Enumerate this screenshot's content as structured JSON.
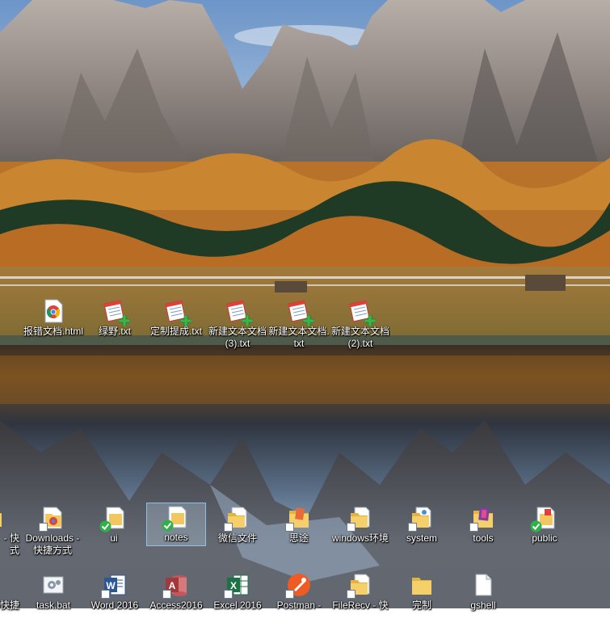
{
  "desktop": {
    "row1": [
      {
        "label": "报错文档.html",
        "icon": "chrome-html-file-icon"
      },
      {
        "label": "绿野.txt",
        "icon": "notepad-text-file-icon"
      },
      {
        "label": "定制提成.txt",
        "icon": "notepad-text-file-icon"
      },
      {
        "label": "新建文本文档 (3).txt",
        "icon": "notepad-text-file-icon"
      },
      {
        "label": "新建文本文档.txt",
        "icon": "notepad-text-file-icon"
      },
      {
        "label": "新建文本文档 (2).txt",
        "icon": "notepad-text-file-icon"
      }
    ],
    "row2": [
      {
        "label": "- 快\n式",
        "icon": "folder-shortcut-icon"
      },
      {
        "label": "Downloads - 快捷方式",
        "icon": "folder-shortcut-icon"
      },
      {
        "label": "ui",
        "icon": "synced-folder-icon"
      },
      {
        "label": "notes",
        "icon": "synced-folder-icon"
      },
      {
        "label": "微信文件",
        "icon": "folder-shortcut-icon"
      },
      {
        "label": "思途",
        "icon": "folder-shortcut-icon"
      },
      {
        "label": "windows环境",
        "icon": "folder-shortcut-icon"
      },
      {
        "label": "system",
        "icon": "folder-shortcut-icon"
      },
      {
        "label": "tools",
        "icon": "folder-shortcut-icon"
      },
      {
        "label": "public",
        "icon": "synced-folder-icon"
      }
    ],
    "row3": [
      {
        "label": "快捷",
        "icon": "app-shortcut-icon"
      },
      {
        "label": "task.bat",
        "icon": "batch-file-icon"
      },
      {
        "label": "Word 2016",
        "icon": "word-icon"
      },
      {
        "label": "Access2016",
        "icon": "access-icon"
      },
      {
        "label": "Excel 2016",
        "icon": "excel-icon"
      },
      {
        "label": "Postman - ",
        "icon": "postman-icon"
      },
      {
        "label": "FileRecv - 快",
        "icon": "folder-shortcut-icon"
      },
      {
        "label": "完制",
        "icon": "folder-icon"
      },
      {
        "label": "gshell",
        "icon": "blank-file-icon"
      }
    ]
  },
  "colors": {
    "sky": "#8fb3d9",
    "folder": "#f3c75f",
    "check": "#2fb14a",
    "word": "#2b5797",
    "excel": "#1e7145",
    "access": "#a4373a",
    "postman": "#ef5b25"
  }
}
